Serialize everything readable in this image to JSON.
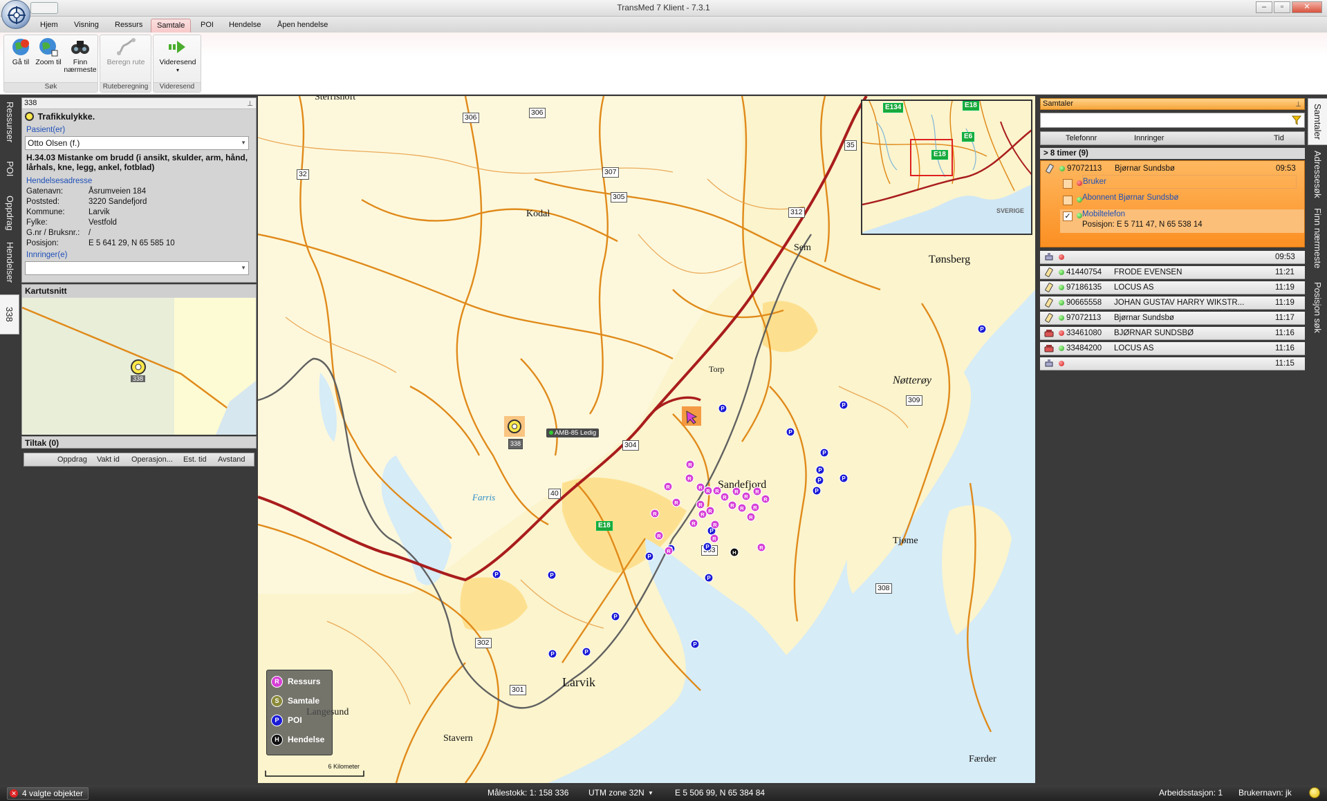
{
  "window": {
    "title": "TransMed 7 Klient - 7.3.1"
  },
  "tabs": [
    "Hjem",
    "Visning",
    "Ressurs",
    "Samtale",
    "POI",
    "Hendelse",
    "Åpen hendelse"
  ],
  "active_tab": "Samtale",
  "ribbon": {
    "groups": [
      {
        "label": "Søk",
        "buttons": [
          {
            "label": "Gå til",
            "icon": "globe-red-icon"
          },
          {
            "label": "Zoom til",
            "icon": "globe-zoom-icon"
          },
          {
            "label": "Finn nærmeste",
            "icon": "binoculars-icon"
          }
        ]
      },
      {
        "label": "Ruteberegning",
        "buttons": [
          {
            "label": "Beregn rute",
            "icon": "route-icon",
            "disabled": true
          }
        ]
      },
      {
        "label": "Videresend",
        "buttons": [
          {
            "label": "Videresend",
            "icon": "forward-arrow-icon"
          }
        ]
      }
    ]
  },
  "left_tabs": [
    "Ressurser",
    "POI",
    "Oppdrag",
    "Hendelser",
    "338"
  ],
  "incident": {
    "panel_title": "338",
    "type": "Trafikkulykke.",
    "patients_label": "Pasient(er)",
    "patient": "Otto Olsen (f.)",
    "diagnosis": "H.34.03 Mistanke om brudd (i ansikt, skulder, arm, hånd, lårhals, kne, legg, ankel, fotblad)",
    "address_label": "Hendelsesadresse",
    "fields": [
      {
        "k": "Gatenavn:",
        "v": "Åsrumveien 184"
      },
      {
        "k": "Poststed:",
        "v": "3220 Sandefjord"
      },
      {
        "k": "Kommune:",
        "v": "Larvik"
      },
      {
        "k": "Fylke:",
        "v": "Vestfold"
      },
      {
        "k": "G.nr / Bruksnr.:",
        "v": "  /"
      },
      {
        "k": "Posisjon:",
        "v": "E 5 641 29, N 65 585 10"
      }
    ],
    "calls_label": "Innringer(e)"
  },
  "kartutsnitt": {
    "title": "Kartutsnitt",
    "marker_label": "338"
  },
  "tiltak": {
    "title": "Tiltak (0)",
    "columns": [
      "Oppdrag",
      "Vakt id",
      "Operasjon...",
      "Est. tid",
      "Avstand"
    ]
  },
  "map": {
    "towns": [
      "Sterrishoft",
      "Kodal",
      "Sem",
      "Tønsberg",
      "Torp",
      "Nøtterøy",
      "Sandefjord",
      "Tjøme",
      "Larvik",
      "Langesund",
      "Stavern",
      "Færder",
      "Farris"
    ],
    "roads": [
      "306",
      "306",
      "32",
      "307",
      "305",
      "312",
      "35",
      "304",
      "40",
      "302",
      "301",
      "308",
      "309",
      "303"
    ],
    "highways": [
      "E18",
      "E18",
      "E134",
      "E18",
      "E6",
      "E18"
    ],
    "overview_country": "SVERIGE",
    "incident_marker": "338",
    "ambulance": "AMB-85 Ledig",
    "scale_label": "6 Kilometer",
    "legend": [
      {
        "label": "Ressurs",
        "letter": "R",
        "color": "#d63fd6"
      },
      {
        "label": "Samtale",
        "letter": "S",
        "color": "#8a8a3a"
      },
      {
        "label": "POI",
        "letter": "P",
        "color": "#1a1ad6"
      },
      {
        "label": "Hendelse",
        "letter": "H",
        "color": "#111111"
      }
    ]
  },
  "right_tabs": [
    "Samtaler",
    "Adressesøk",
    "Finn nærmeste",
    "Posisjon søk"
  ],
  "samtaler": {
    "title": "Samtaler",
    "columns": [
      "Telefonnr",
      "Innringer",
      "Tid"
    ],
    "group": "> 8 timer (9)",
    "selected": {
      "phone": "97072113",
      "name": "Bjørnar Sundsbø",
      "time": "09:53",
      "subs": [
        {
          "label": "Bruker",
          "status": "red"
        },
        {
          "label": "Abonnent Bjørnar Sundsbø",
          "status": "green"
        },
        {
          "label": "Mobiltelefon",
          "status": "green",
          "detail": "Posisjon: E 5 711 47, N 65 538 14",
          "checked": true
        }
      ]
    },
    "rows": [
      {
        "phone": "",
        "name": "",
        "time": "09:53",
        "status": "red"
      },
      {
        "phone": "41440754",
        "name": "FRODE EVENSEN",
        "time": "11:21",
        "status": "green"
      },
      {
        "phone": "97186135",
        "name": "LOCUS AS",
        "time": "11:19",
        "status": "green"
      },
      {
        "phone": "90665558",
        "name": "JOHAN GUSTAV HARRY WIKSTR...",
        "time": "11:19",
        "status": "green"
      },
      {
        "phone": "97072113",
        "name": "Bjørnar Sundsbø",
        "time": "11:17",
        "status": "green"
      },
      {
        "phone": "33461080",
        "name": "BJØRNAR SUNDSBØ",
        "time": "11:16",
        "status": "red"
      },
      {
        "phone": "33484200",
        "name": "LOCUS AS",
        "time": "11:16",
        "status": "green"
      },
      {
        "phone": "",
        "name": "",
        "time": "11:15",
        "status": "red"
      }
    ]
  },
  "status": {
    "selected": "4 valgte objekter",
    "scale": "Målestokk:  1: 158 336",
    "zone": "UTM zone 32N",
    "coords": "E 5 506 99, N 65 384 84",
    "station": "Arbeidsstasjon:  1",
    "user": "Brukernavn:  jk"
  }
}
